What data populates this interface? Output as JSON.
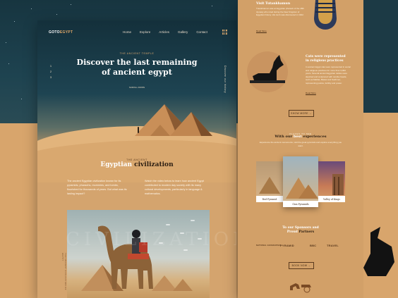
{
  "left": {
    "logo": {
      "main": "GOTO",
      "accent": "EGYPT"
    },
    "nav": [
      "Home",
      "Explore",
      "Articles",
      "Gallery",
      "Contact"
    ],
    "hero": {
      "eyebrow": "THE ANCIENT TEMPLE",
      "title_line1": "Discover the last remaining",
      "title_line2": "of ancient egypt",
      "side_numbers": [
        "1",
        "2",
        "3"
      ],
      "vertical_text": "Discover our history",
      "scroll_label": "SCROLL DOWN"
    },
    "civilization": {
      "eyebrow": "THE ANCIENT",
      "title_accent": "Egyptian",
      "title_rest": "civilization",
      "col1": "The ancient Egyptian civilization known for its pyramids, pharaohs, mummies, and tombs, flourished for thousands of years. But what was its lasting impact?",
      "col2": "Watch the video below to learn how ancient Egypt contributed to modern day society with its many cultural developments, particularly in language & mathematics."
    },
    "watermark": "CIVILIZATION",
    "photo_vertical": "THE ANCIENT CIVILIZATION OF EGYPT"
  },
  "right": {
    "block1": {
      "title": "Visit Tutankhamun",
      "text": "Tutankhamun was an Egyptian pharaoh of the 18th dynasty who ruled during the New Kingdom of Egyptian history. His tomb was discovered in 1922.",
      "link": "Read More"
    },
    "block2": {
      "title_line1": "Cats were represented",
      "title_line2": "in religious practices",
      "text": "In ancient Egypt cats were represented in social and religious practices for more than 3,000 years. Several ancient Egyptian deities were depicted and sculptured with cat-like heads, such as Mafdet, Bastet and Sekhmet, representing justice, fertility and power.",
      "link": "Read More"
    },
    "show_more": "SHOW MORE",
    "experiences": {
      "eyebrow": "PLACES TO SEE",
      "title_pre": "With our ",
      "title_accent": "best",
      "title_post": " experiences",
      "text": "Experience the ancient monuments, visit the great pyramids and explore everything you want."
    },
    "cards": [
      "Red Pyramid",
      "Giza Pyramids",
      "Valley of Kings"
    ],
    "sponsors": {
      "title_line1": "To our Sponsors and",
      "title_line2": "Partners",
      "title_line2_accent": "Proud",
      "logos": [
        "NATIONAL GEOGRAPHIC",
        "PYRAMID",
        "BBC",
        "TRAVEL"
      ]
    },
    "book_now": "BOOK NOW"
  },
  "colors": {
    "sand": "#d4a46e",
    "sky": "#1e4350",
    "accent_text": "#ffffff",
    "dark_text": "#2c1e12"
  }
}
